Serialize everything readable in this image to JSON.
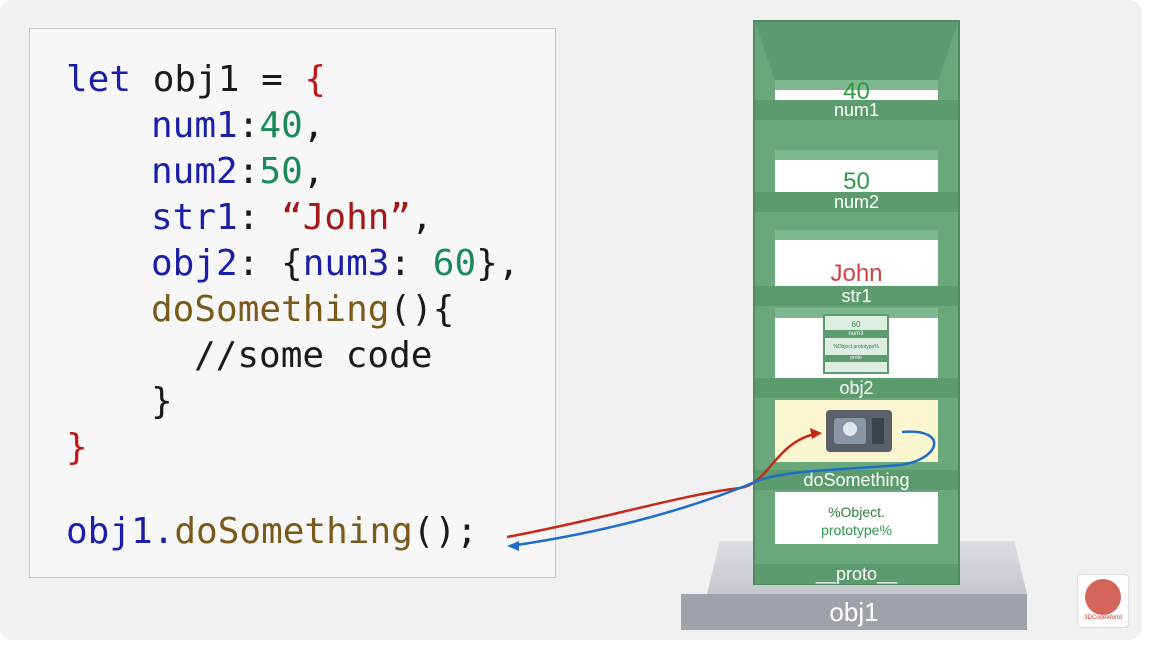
{
  "code": {
    "line1": {
      "kw": "let",
      "name": " obj1 = ",
      "brace": "{"
    },
    "line2": {
      "prop": "num1",
      "sep": ":",
      "value": "40",
      "end": ","
    },
    "line3": {
      "prop": "num2",
      "sep": ":",
      "value": "50",
      "end": ","
    },
    "line4": {
      "prop": "str1",
      "sep": ": ",
      "value": "“John”",
      "end": ","
    },
    "line5": {
      "prop": "obj2",
      "sep": ": {",
      "inner": "num3",
      "sep2": ": ",
      "value": "60",
      "end": "},"
    },
    "line6": {
      "fn": "doSomething",
      "rest": "(){"
    },
    "line7": {
      "comment": "//some code"
    },
    "line8": {
      "brace": "}"
    },
    "line9": {
      "brace": "}"
    },
    "line10": {
      "obj": "obj1.",
      "fn": "doSomething",
      "rest": "();"
    }
  },
  "tower": {
    "num1": {
      "label": "num1",
      "value": "40"
    },
    "num2": {
      "label": "num2",
      "value": "50"
    },
    "str1": {
      "label": "str1",
      "value": "John"
    },
    "obj2": {
      "label": "obj2",
      "mini_value": "60",
      "mini_label": "num3",
      "mini_proto": "%Object.prototype%",
      "mini_proto_label": "proto"
    },
    "doSomething": {
      "label": "doSomething"
    },
    "proto": {
      "label": "__proto__",
      "value_line1": "%Object.",
      "value_line2": "prototype%"
    },
    "base_label": "obj1"
  },
  "logo": {
    "text": "3DCodeWorld"
  },
  "colors": {
    "green": "#6aa87c",
    "red_arrow": "#c42a1a",
    "blue_arrow": "#1f6fc9"
  }
}
